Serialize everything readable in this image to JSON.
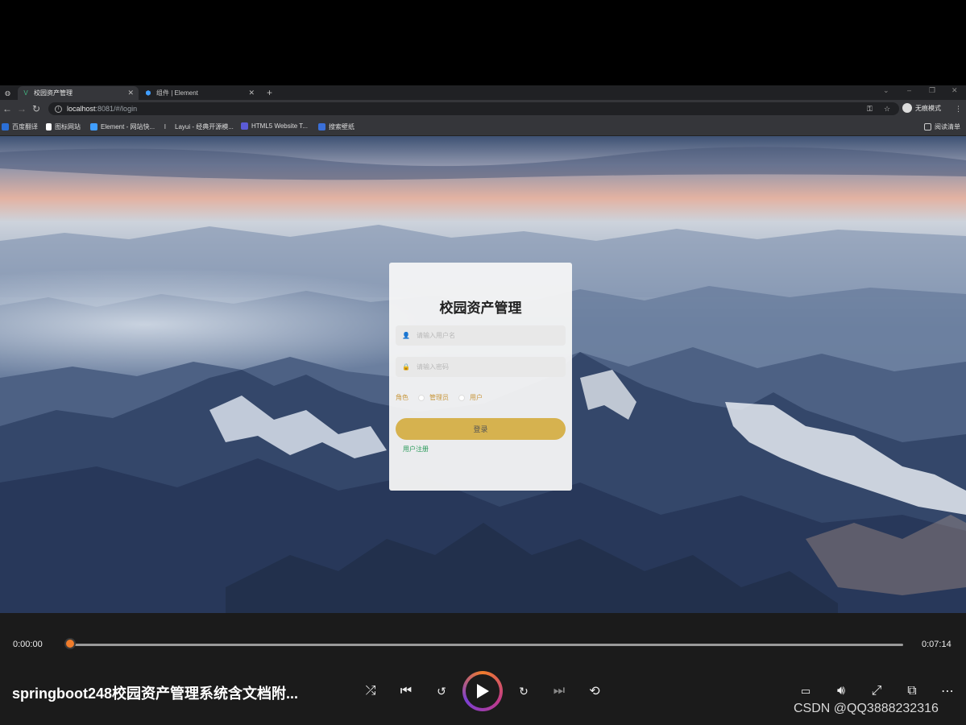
{
  "browser": {
    "tabs": [
      {
        "label": "校园资产管理",
        "active": true
      },
      {
        "label": "组件 | Element",
        "active": false
      }
    ],
    "address": {
      "host": "localhost",
      "rest": ":8081/#/login"
    },
    "profile_label": "无痕模式",
    "bookmarks": [
      "百度翻译",
      "图标网站",
      "Element - 网站快...",
      "Layui - 经典开源模...",
      "HTML5 Website T...",
      "搜索壁纸"
    ],
    "reading_list": "阅读清单"
  },
  "login": {
    "title": "校园资产管理",
    "username_placeholder": "请输入用户名",
    "password_placeholder": "请输入密码",
    "role_label": "角色",
    "roles": [
      "管理员",
      "用户"
    ],
    "login_button": "登录",
    "register_link": "用户注册"
  },
  "player": {
    "current_time": "0:00:00",
    "total_time": "0:07:14",
    "progress": 0.0,
    "title": "springboot248校园资产管理系统含文档附...",
    "watermark": "CSDN @QQ3888232316"
  },
  "colors": {
    "accent_orange": "#f07c2b",
    "login_button": "#d6b24f",
    "register_link": "#2a9a5a"
  }
}
